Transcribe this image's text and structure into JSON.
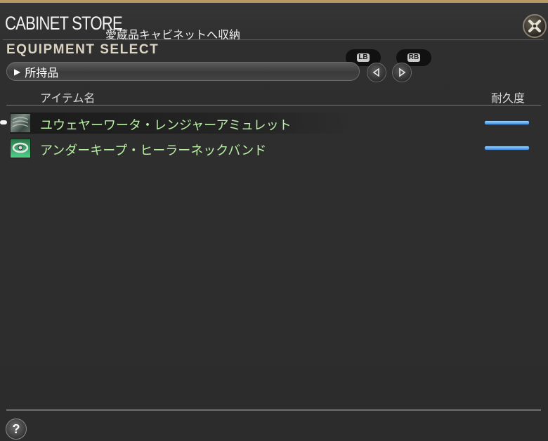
{
  "window": {
    "title": "CABINET STORE",
    "subtitle": "愛蔵品キャビネットへ収納"
  },
  "section": {
    "title": "EQUIPMENT SELECT"
  },
  "filter": {
    "selected": "所持品"
  },
  "shoulder_buttons": {
    "left": "LB",
    "right": "RB"
  },
  "columns": {
    "name": "アイテム名",
    "durability": "耐久度"
  },
  "items": [
    {
      "name": "ユウェヤーワータ・レンジャーアミュレット",
      "icon": "amulet-icon",
      "durability": 1.0,
      "selected": true
    },
    {
      "name": "アンダーキープ・ヒーラーネックバンド",
      "icon": "necklace-icon",
      "durability": 1.0,
      "selected": false
    }
  ],
  "colors": {
    "accent_gold": "#b59a62",
    "item_name": "#b9f0a6",
    "durability_bar": "#5aa8f0"
  }
}
